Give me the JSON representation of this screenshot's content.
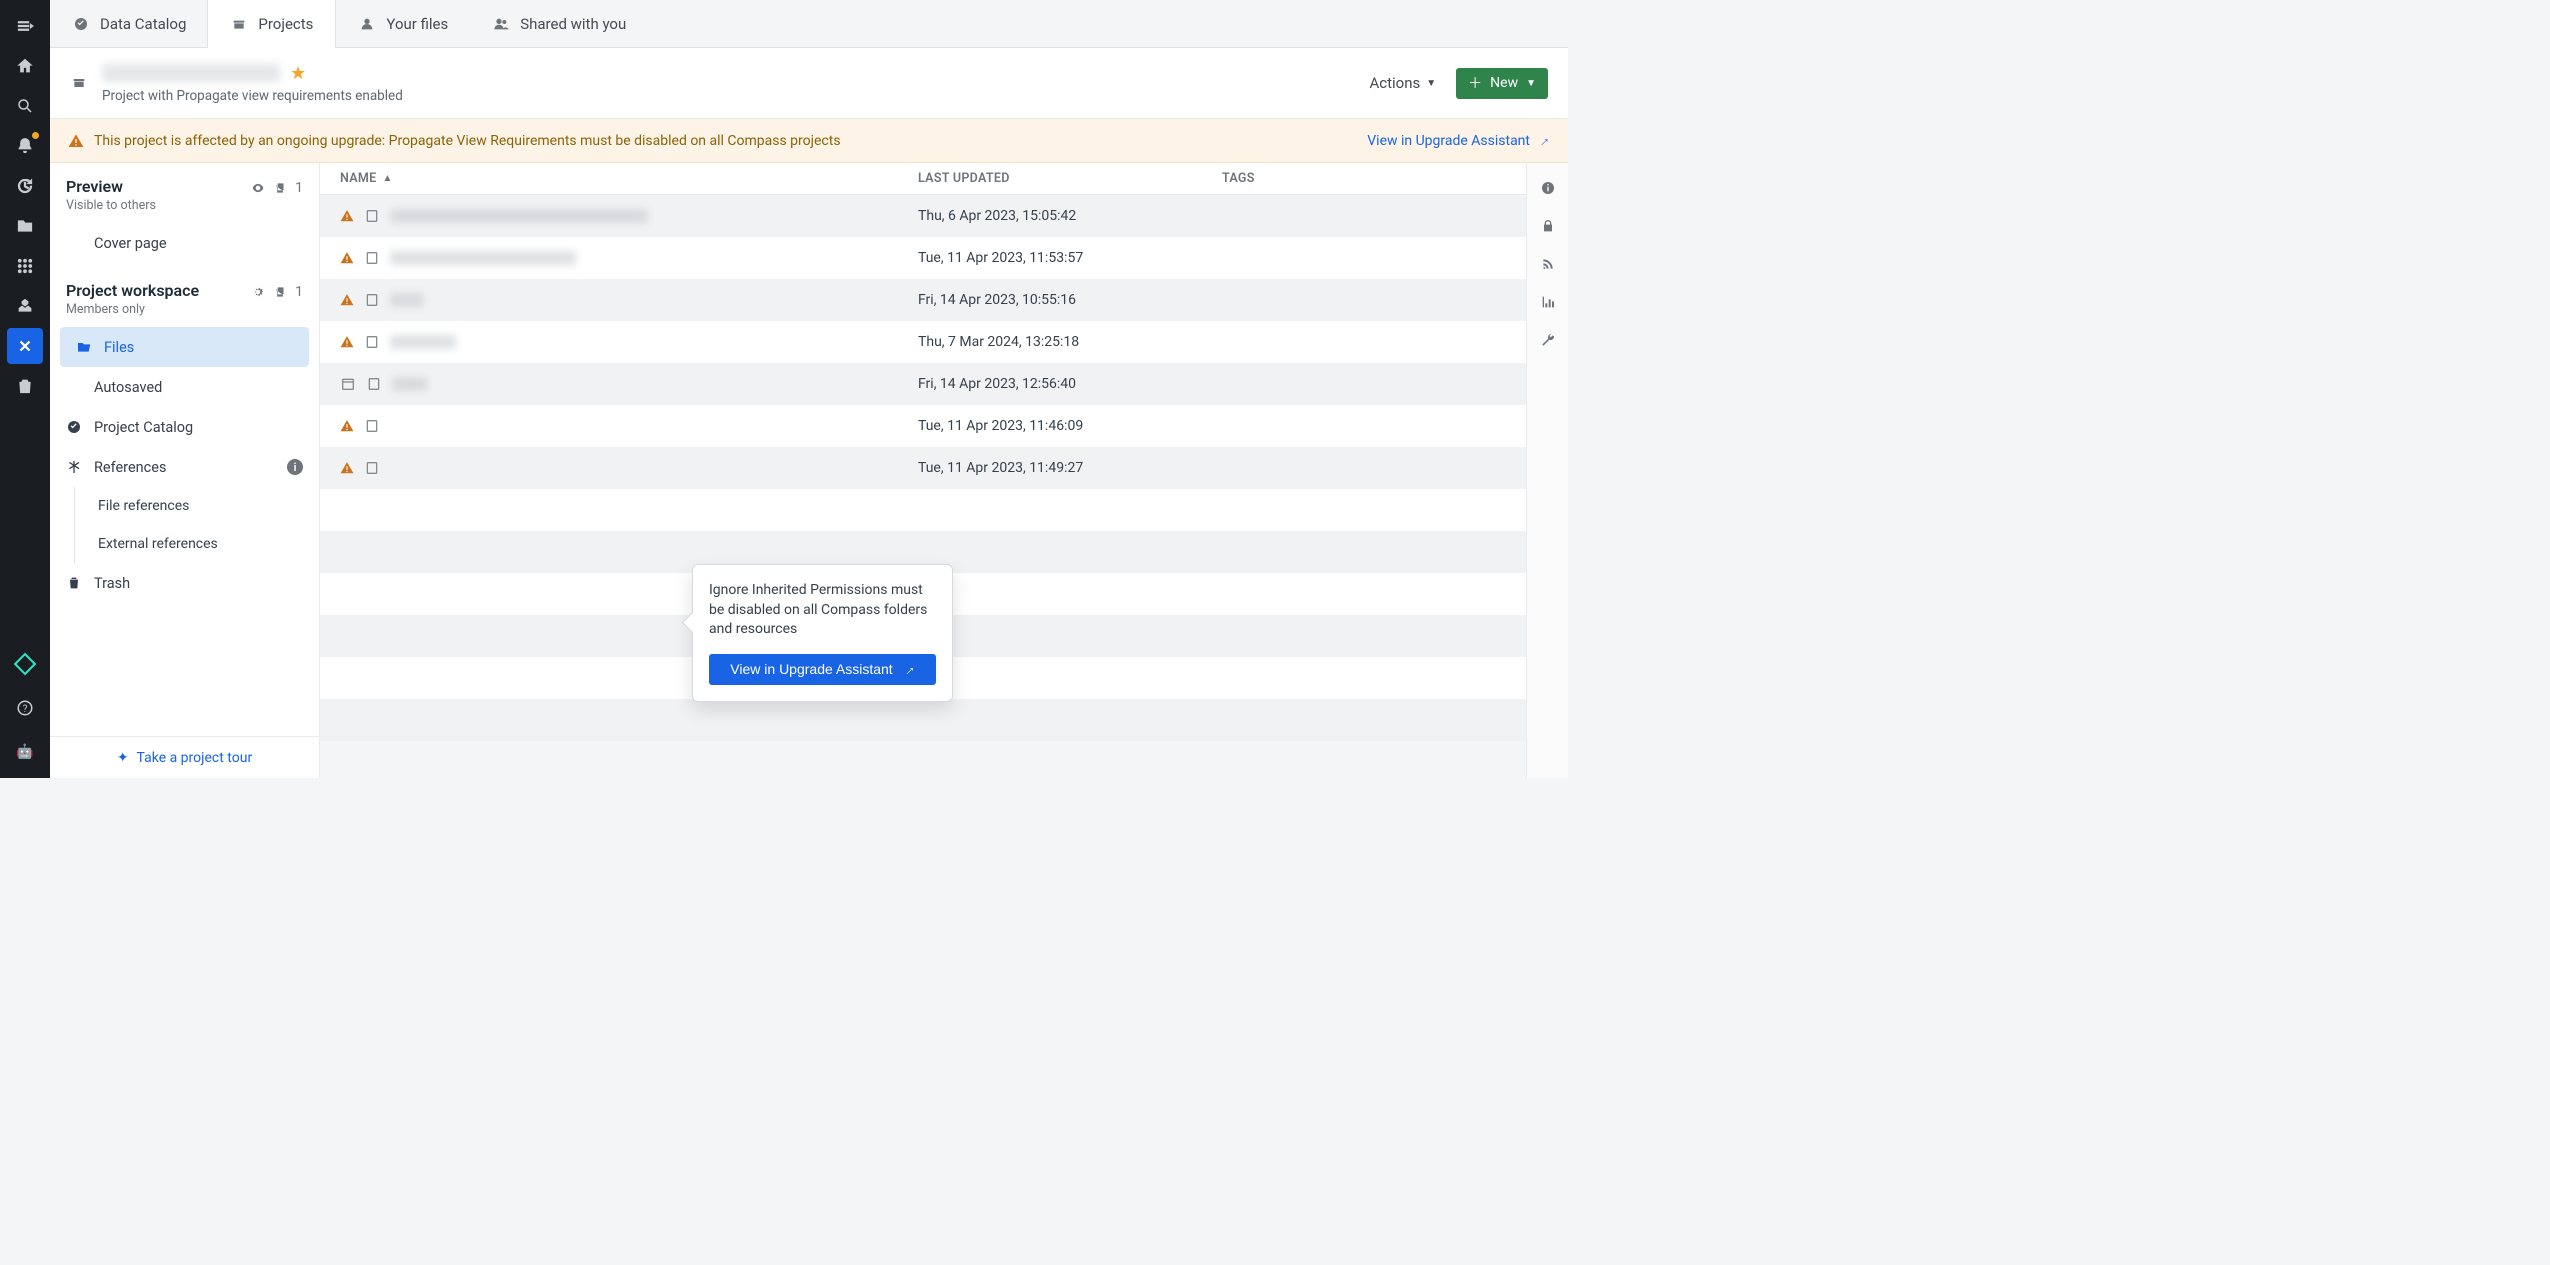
{
  "tabs": [
    {
      "label": "Data Catalog"
    },
    {
      "label": "Projects"
    },
    {
      "label": "Your files"
    },
    {
      "label": "Shared with you"
    }
  ],
  "project": {
    "subtitle": "Project with Propagate view requirements enabled",
    "actions_label": "Actions",
    "new_label": "New"
  },
  "banner": {
    "text": "This project is affected by an ongoing upgrade: Propagate View Requirements must be disabled on all Compass projects",
    "link": "View in Upgrade Assistant"
  },
  "sidebar": {
    "preview": {
      "title": "Preview",
      "subtitle": "Visible to others",
      "count": "1"
    },
    "cover": "Cover page",
    "workspace": {
      "title": "Project workspace",
      "subtitle": "Members only",
      "count": "1"
    },
    "files": "Files",
    "autosaved": "Autosaved",
    "catalog": "Project Catalog",
    "references": "References",
    "file_refs": "File references",
    "ext_refs": "External references",
    "trash": "Trash",
    "tour": "Take a project tour"
  },
  "columns": {
    "name": "NAME",
    "updated": "LAST UPDATED",
    "tags": "TAGS"
  },
  "rows": [
    {
      "warn": true,
      "blur_w": 258,
      "updated": "Thu, 6 Apr 2023, 15:05:42"
    },
    {
      "warn": true,
      "blur_w": 186,
      "updated": "Tue, 11 Apr 2023, 11:53:57"
    },
    {
      "warn": true,
      "blur_w": 34,
      "updated": "Fri, 14 Apr 2023, 10:55:16"
    },
    {
      "warn": true,
      "blur_w": 66,
      "updated": "Thu, 7 Mar 2024, 13:25:18"
    },
    {
      "warn": false,
      "blur_w": 36,
      "updated": "Fri, 14 Apr 2023, 12:56:40"
    },
    {
      "warn": true,
      "blur_w": 0,
      "updated": "Tue, 11 Apr 2023, 11:46:09"
    },
    {
      "warn": true,
      "blur_w": 0,
      "updated": "Tue, 11 Apr 2023, 11:49:27"
    }
  ],
  "popover": {
    "text": "Ignore Inherited Permissions must be disabled on all Compass folders and resources",
    "button": "View in Upgrade Assistant"
  }
}
